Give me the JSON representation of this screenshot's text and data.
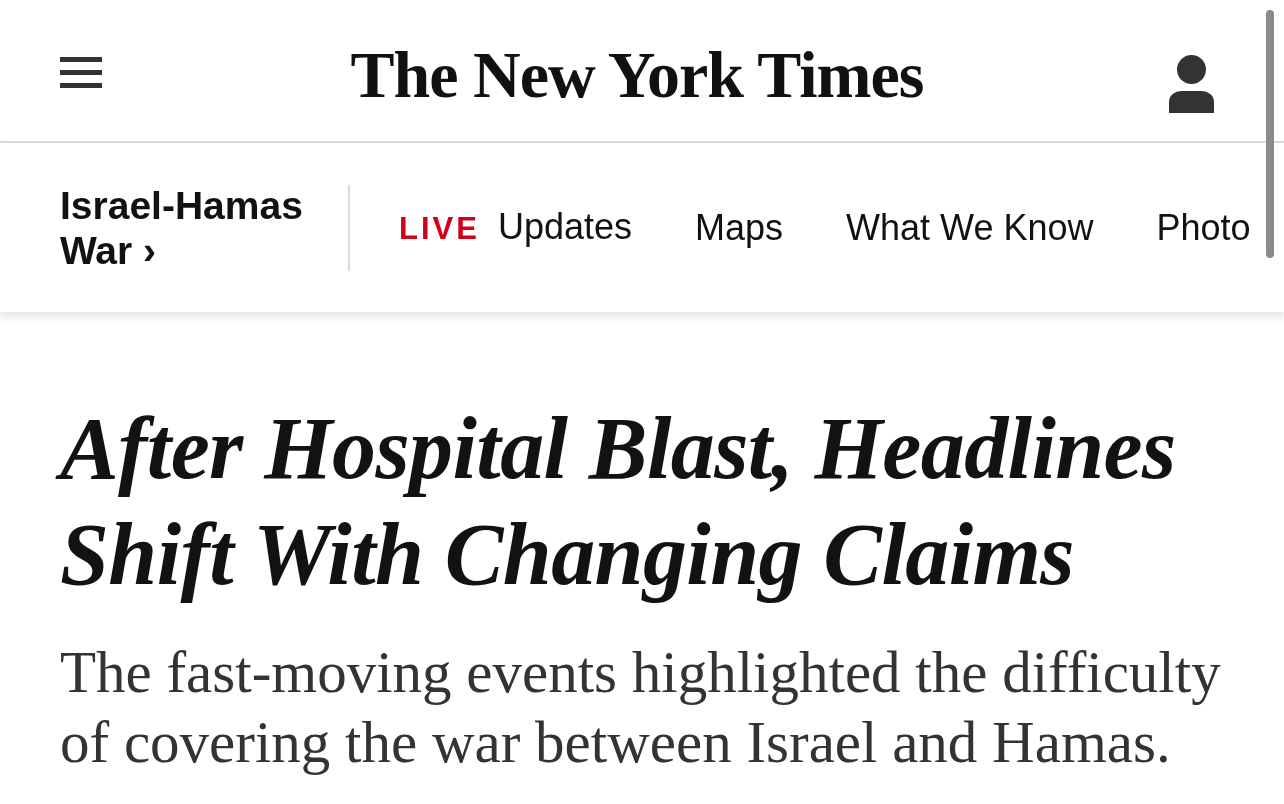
{
  "header": {
    "logo": "The New York Times"
  },
  "nav": {
    "section": {
      "label": "Israel-Hamas War",
      "chevron": "›"
    },
    "links": [
      {
        "kind": "live",
        "badge": "LIVE",
        "label": "Updates"
      },
      {
        "kind": "plain",
        "label": "Maps"
      },
      {
        "kind": "plain",
        "label": "What We Know"
      },
      {
        "kind": "plain",
        "label": "Photo"
      }
    ]
  },
  "article": {
    "headline": "After Hospital Blast, Headlines Shift With Changing Claims",
    "summary": "The fast-moving events highlighted the difficulty of covering the war between Israel and Hamas."
  }
}
